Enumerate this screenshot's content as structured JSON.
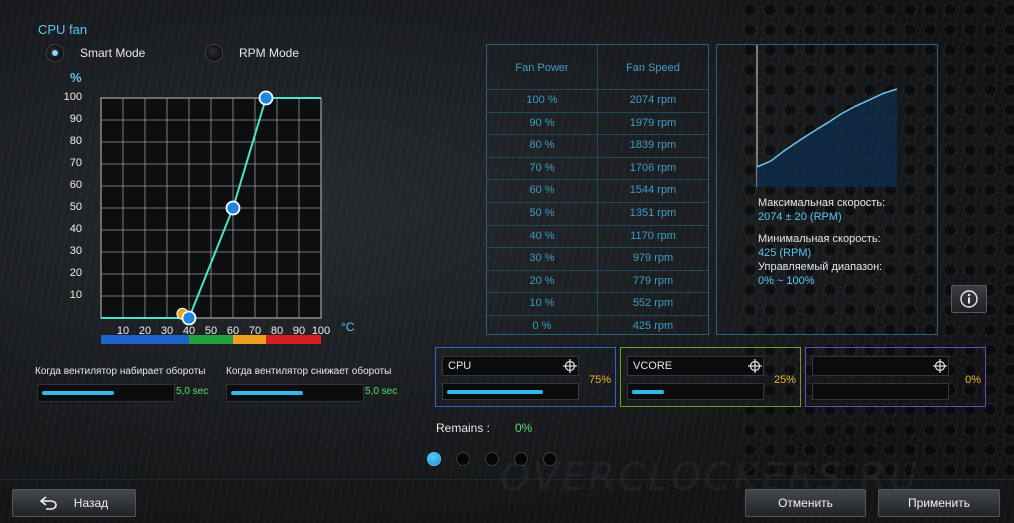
{
  "title": "CPU fan",
  "modes": [
    {
      "label": "Smart Mode",
      "selected": true
    },
    {
      "label": "RPM Mode",
      "selected": false
    }
  ],
  "fan_curve": {
    "y_unit": "%",
    "x_unit": "°C",
    "y_ticks": [
      "100",
      "90",
      "80",
      "70",
      "60",
      "50",
      "40",
      "30",
      "20",
      "10"
    ],
    "x_ticks": [
      "10",
      "20",
      "30",
      "40",
      "50",
      "60",
      "70",
      "80",
      "90",
      "100"
    ],
    "points": [
      {
        "temp": 40,
        "power": 0
      },
      {
        "temp": 60,
        "power": 50
      },
      {
        "temp": 75,
        "power": 100
      }
    ],
    "marker_temp": 37,
    "marker_power": 1,
    "temp_bands": [
      {
        "color": "#1e63c8",
        "from": 0,
        "to": 40
      },
      {
        "color": "#22a040",
        "from": 40,
        "to": 60
      },
      {
        "color": "#f0a020",
        "from": 60,
        "to": 75
      },
      {
        "color": "#d42020",
        "from": 75,
        "to": 100
      }
    ]
  },
  "spin_up": {
    "label": "Когда вентилятор набирает обороты",
    "value": "5,0 sec",
    "level": 0.55
  },
  "spin_down": {
    "label": "Когда вентилятор снижает обороты",
    "value": "5,0 sec",
    "level": 0.55
  },
  "table": {
    "headers": [
      "Fan Power",
      "Fan Speed"
    ],
    "rows": [
      [
        "100 %",
        "2074 rpm"
      ],
      [
        "90 %",
        "1979 rpm"
      ],
      [
        "80 %",
        "1839 rpm"
      ],
      [
        "70 %",
        "1706 rpm"
      ],
      [
        "60 %",
        "1544 rpm"
      ],
      [
        "50 %",
        "1351 rpm"
      ],
      [
        "40 %",
        "1170 rpm"
      ],
      [
        "30 %",
        "979 rpm"
      ],
      [
        "20 %",
        "779 rpm"
      ],
      [
        "10 %",
        "552 rpm"
      ],
      [
        "0 %",
        "425 rpm"
      ]
    ]
  },
  "speed_info": {
    "max_label": "Максимальная скорость:",
    "max_value": "2074 ± 20 (RPM)",
    "min_label": "Минимальная скорость:",
    "min_value": "425 (RPM)",
    "range_label": "Управляемый диапазон:",
    "range_value": "0% ~ 100%"
  },
  "sensors": [
    {
      "name": "CPU",
      "percent": "75%",
      "level": 0.75,
      "border": "#2f64c8"
    },
    {
      "name": "VCORE",
      "percent": "25%",
      "level": 0.25,
      "border": "#6aa030"
    },
    {
      "name": "",
      "percent": "0%",
      "level": 0,
      "border": "#7a44b8"
    }
  ],
  "remains": {
    "label": "Remains :",
    "value": "0%"
  },
  "pages": {
    "count": 5,
    "active": 0
  },
  "buttons": {
    "back": "Назад",
    "cancel": "Отменить",
    "apply": "Применить"
  },
  "colors": {
    "accent": "#5ac8f0",
    "green": "#56e070",
    "orange": "#f2b830"
  }
}
